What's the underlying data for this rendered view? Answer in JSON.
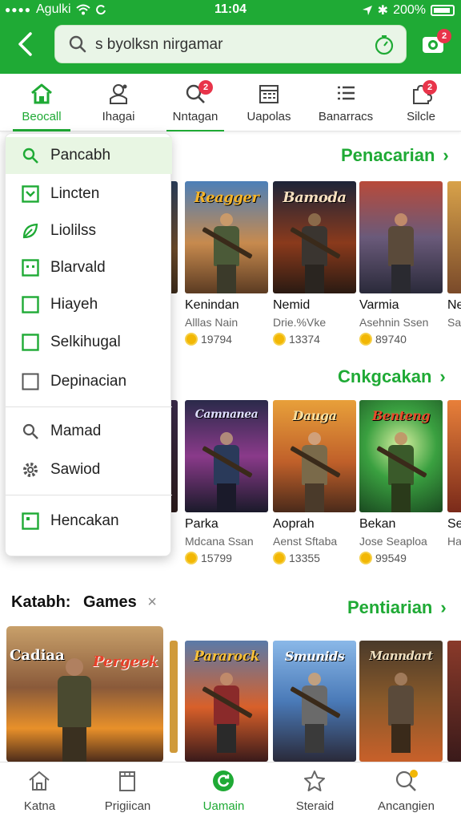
{
  "status_bar": {
    "carrier": "Agulki",
    "time": "11:04",
    "battery": "200%"
  },
  "header": {
    "search_value": "s byolksn nirgamar",
    "cart_badge": "2"
  },
  "tabs": [
    {
      "label": "Beocall",
      "icon": "home-icon",
      "active": true
    },
    {
      "label": "Ihagai",
      "icon": "user-icon",
      "badge": ""
    },
    {
      "label": "Nntagan",
      "icon": "search-icon",
      "badge": "2"
    },
    {
      "label": "Uapolas",
      "icon": "calendar-icon"
    },
    {
      "label": "Banarracs",
      "icon": "list-icon"
    },
    {
      "label": "Silcle",
      "icon": "puzzle-icon",
      "badge": "2"
    }
  ],
  "menu": {
    "items": [
      {
        "label": "Pancabh",
        "icon": "search-icon"
      },
      {
        "label": "Lincten",
        "icon": "checkbox-checked-icon"
      },
      {
        "label": "Liolilss",
        "icon": "leaf-icon"
      },
      {
        "label": "Blarvald",
        "icon": "face-box-icon"
      },
      {
        "label": "Hiayeh",
        "icon": "checkbox-icon"
      },
      {
        "label": "Selkihugal",
        "icon": "checkbox-icon"
      },
      {
        "label": "Depinacian",
        "icon": "checkbox-empty-icon"
      },
      {
        "label": "Mamad",
        "icon": "search-icon"
      },
      {
        "label": "Sawiod",
        "icon": "gear-icon"
      },
      {
        "label": "Hencakan",
        "icon": "square-dot-icon"
      }
    ]
  },
  "sections": [
    {
      "link_label": "Penacarian",
      "games": [
        {
          "cover": "Reagger",
          "name": "Kenindan",
          "sub": "Alllas Nain",
          "stat": "19794"
        },
        {
          "cover": "Bamoda",
          "name": "Nemid",
          "sub": "Drie.%Vke",
          "stat": "13374"
        },
        {
          "cover": "",
          "name": "Varmia",
          "sub": "Asehnin Ssen",
          "stat": "89740"
        },
        {
          "cover": "",
          "name": "Ne",
          "sub": "Sa",
          "stat": ""
        }
      ]
    },
    {
      "link_label": "Cnkgcakan",
      "games": [
        {
          "cover": "Camnanea",
          "name": "Parka",
          "sub": "Mdcana Ssan",
          "stat": "15799"
        },
        {
          "cover": "Dauga",
          "name": "Aoprah",
          "sub": "Aenst Sftaba",
          "stat": "13355"
        },
        {
          "cover": "Benteng",
          "name": "Bekan",
          "sub": "Jose Seaploa",
          "stat": "99549"
        },
        {
          "cover": "",
          "name": "Se",
          "sub": "Ha",
          "stat": ""
        }
      ]
    },
    {
      "link_label": "Pentiarian",
      "games": [
        {
          "cover": "Pararock"
        },
        {
          "cover": "Smunids"
        },
        {
          "cover": "Manndart"
        }
      ]
    }
  ],
  "featured": {
    "title_prefix": "Katabh:",
    "title_main": "Games",
    "close": "×",
    "cover_left": "Cadiaa",
    "cover_right": "Pergeek"
  },
  "bottom_nav": [
    {
      "label": "Katna",
      "icon": "home-icon"
    },
    {
      "label": "Prigiican",
      "icon": "bookmark-icon"
    },
    {
      "label": "Uamain",
      "icon": "refresh-icon",
      "active": true
    },
    {
      "label": "Steraid",
      "icon": "star-icon"
    },
    {
      "label": "Ancangien",
      "icon": "search-icon"
    }
  ],
  "colors": {
    "brand": "#1faa35",
    "badge": "#e8344a"
  }
}
